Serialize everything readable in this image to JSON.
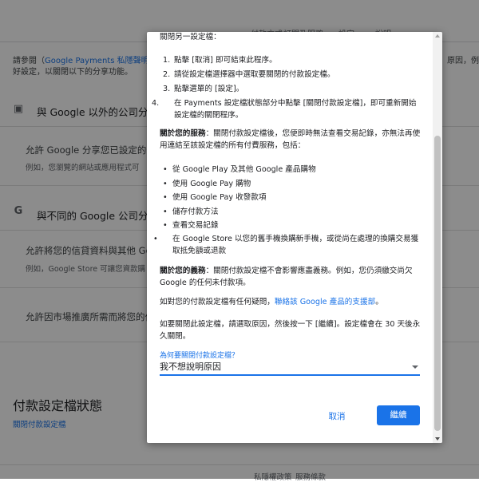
{
  "background": {
    "nav_items": [
      "付款方式",
      "訂閱及服務",
      "設定",
      "說明"
    ],
    "intro_prefix": "請參閱（",
    "intro_link": "Google Payments 私隱聲明",
    "intro_suffix": "）",
    "intro_right": "原因，例如",
    "intro_line2": "好設定，以關閉以下的分享功能。",
    "section1_title": "與 Google 以外的公司分享",
    "section1_item_title": "允許 Google 分享您已設定的付",
    "section1_item_desc": "例如，您瀏覽的網站或應用程式可",
    "section2_title": "與不同的 Google 公司分享",
    "section2_item_title": "允許將您的信貸資料與其他 Go",
    "section2_item_desc": "例如，Google Store 可讓您資款購",
    "section2_item2_title": "允許因市場推廣所需而將您的付",
    "profile_status_title": "付款設定檔狀態",
    "close_profile_link": "關閉付款設定檔",
    "footer_items": [
      "私隱權政策",
      "服務條款"
    ]
  },
  "dialog": {
    "top_text": "關閉另一設定檔：",
    "steps": [
      "點擊 [取消] 即可結束此程序。",
      "請從設定檔選擇器中選取要關閉的付款設定檔。",
      "點擊選單的 [設定]。",
      "在 Payments 設定檔狀態部分中點擊 [關閉付款設定檔]，即可重新開始設定檔的關閉程序。"
    ],
    "services_bold": "關於您的服務",
    "services_text": "：關閉付款設定檔後，您便即時無法查看交易記錄，亦無法再使用連結至該設定檔的所有付費服務，包括：",
    "services_list": [
      "從 Google Play 及其他 Google 產品購物",
      "使用 Google Pay 購物",
      "使用 Google Pay 收發款項",
      "儲存付款方法",
      "查看交易記錄",
      "在 Google Store 以您的舊手機換購新手機，或從尚在處理的換購交易獲取抵免額或退款"
    ],
    "obligations_bold": "關於您的義務",
    "obligations_text": "：關閉付款設定檔不會影響應盡義務。例如，您仍須繳交尚欠 Google 的任何未付款項。",
    "question_prefix": "如對您的付款設定檔有任何疑問，",
    "question_link": "聯絡該 Google 產品的支援部",
    "question_suffix": "。",
    "close_note": "如要關閉此設定檔，請選取原因，然後按一下 [繼續]。設定檔會在 30 天後永久關閉。",
    "select_label": "為何要關閉付款設定檔？",
    "select_value": "我不想說明原因",
    "cancel_label": "取消",
    "continue_label": "繼續"
  },
  "colors": {
    "accent": "#1a73e8",
    "scrim": "rgba(0,0,0,0.45)"
  }
}
